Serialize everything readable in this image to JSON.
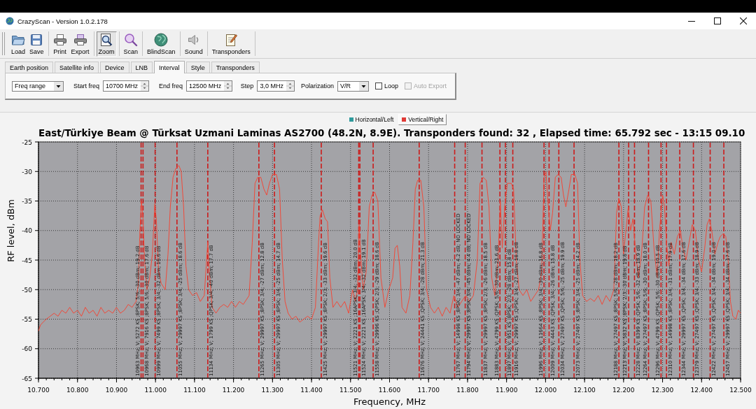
{
  "window": {
    "title": "CrazyScan - Version 1.0.2.178"
  },
  "toolbar": [
    {
      "buttons": [
        {
          "label": "Load",
          "pressed": false
        },
        {
          "label": "Save",
          "pressed": false
        }
      ]
    },
    {
      "buttons": [
        {
          "label": "Print",
          "pressed": false
        },
        {
          "label": "Export",
          "pressed": false
        }
      ]
    },
    {
      "buttons": [
        {
          "label": "Zoom",
          "pressed": true
        }
      ]
    },
    {
      "buttons": [
        {
          "label": "Scan",
          "pressed": false
        }
      ]
    },
    {
      "buttons": [
        {
          "label": "BlindScan",
          "pressed": false
        }
      ]
    },
    {
      "buttons": [
        {
          "label": "Sound",
          "pressed": false
        }
      ]
    },
    {
      "buttons": [
        {
          "label": "Transponders",
          "pressed": false
        }
      ]
    }
  ],
  "tabs": [
    {
      "label": "Earth position",
      "selected": false
    },
    {
      "label": "Satellite info",
      "selected": false
    },
    {
      "label": "Device",
      "selected": false
    },
    {
      "label": "LNB",
      "selected": false
    },
    {
      "label": "Interval",
      "selected": true
    },
    {
      "label": "Style",
      "selected": false
    },
    {
      "label": "Transponders",
      "selected": false
    }
  ],
  "interval_panel": {
    "range_controls": [
      {
        "kind": "dropdown",
        "value": "Freq range"
      },
      {
        "kind": "spinbox",
        "label": "Start freq",
        "value": "10700 MHz"
      },
      {
        "kind": "spinbox",
        "label": "End freq",
        "value": "12500 MHz"
      }
    ],
    "scan_controls": [
      {
        "kind": "spinbox",
        "label": "Step",
        "value": "3,0 MHz"
      },
      {
        "kind": "dropdown",
        "label": "Polarization",
        "value": "V/R"
      },
      {
        "kind": "checkbox",
        "label": "Loop",
        "checked": false,
        "disabled": false
      },
      {
        "kind": "checkbox",
        "label": "Auto Export",
        "checked": false,
        "disabled": true
      }
    ]
  },
  "chart": {
    "legend": [
      {
        "label": "Horizontal/Left",
        "color": "#2f9a9c",
        "selected": false
      },
      {
        "label": "Vertical/Right",
        "color": "#e03a36",
        "selected": true
      }
    ],
    "chart_data": {
      "type": "line",
      "title": "East/Türkiye Beam @ Türksat Uzmani Laminas AS2700 (48.2N, 8.9E). Transponders found: 32 , Elapsed time: 65.792 sec - 13:15 09.10",
      "xlabel": "Frequency, MHz",
      "ylabel": "RF level, dBm",
      "grid": true,
      "xlim": [
        10.7,
        12.5
      ],
      "ylim": [
        -65,
        -25
      ],
      "xticks": [
        {
          "value": 10.7,
          "label": "10.700"
        },
        {
          "value": 10.8,
          "label": "10.800"
        },
        {
          "value": 10.9,
          "label": "10.900"
        },
        {
          "value": 11.0,
          "label": "11.000"
        },
        {
          "value": 11.1,
          "label": "11.100"
        },
        {
          "value": 11.2,
          "label": "11.200"
        },
        {
          "value": 11.3,
          "label": "11.300"
        },
        {
          "value": 11.4,
          "label": "11.400"
        },
        {
          "value": 11.5,
          "label": "11.500"
        },
        {
          "value": 11.6,
          "label": "11.600"
        },
        {
          "value": 11.7,
          "label": "11.700"
        },
        {
          "value": 11.8,
          "label": "11.800"
        },
        {
          "value": 11.9,
          "label": "11.900"
        },
        {
          "value": 12.0,
          "label": "12.000"
        },
        {
          "value": 12.1,
          "label": "12.100"
        },
        {
          "value": 12.2,
          "label": "12.200"
        },
        {
          "value": 12.3,
          "label": "12.300"
        },
        {
          "value": 12.4,
          "label": "12.400"
        },
        {
          "value": 12.5,
          "label": "12.500"
        }
      ],
      "yticks": [
        -25,
        -30,
        -35,
        -40,
        -45,
        -50,
        -55,
        -60,
        -65
      ],
      "x": [
        10.7,
        10.705,
        10.712,
        10.72,
        10.73,
        10.74,
        10.75,
        10.76,
        10.77,
        10.78,
        10.79,
        10.8,
        10.81,
        10.82,
        10.83,
        10.84,
        10.85,
        10.86,
        10.87,
        10.88,
        10.89,
        10.9,
        10.91,
        10.92,
        10.93,
        10.94,
        10.95,
        10.956,
        10.96,
        10.964,
        10.968,
        10.972,
        10.978,
        10.985,
        10.992,
        10.998,
        11.002,
        11.008,
        11.015,
        11.025,
        11.032,
        11.038,
        11.045,
        11.052,
        11.06,
        11.066,
        11.072,
        11.078,
        11.085,
        11.095,
        11.105,
        11.115,
        11.125,
        11.13,
        11.134,
        11.138,
        11.145,
        11.155,
        11.165,
        11.175,
        11.185,
        11.195,
        11.205,
        11.215,
        11.225,
        11.24,
        11.248,
        11.255,
        11.262,
        11.27,
        11.278,
        11.285,
        11.292,
        11.3,
        11.31,
        11.318,
        11.325,
        11.332,
        11.34,
        11.35,
        11.36,
        11.37,
        11.38,
        11.39,
        11.4,
        11.41,
        11.418,
        11.422,
        11.428,
        11.435,
        11.441,
        11.447,
        11.455,
        11.465,
        11.475,
        11.485,
        11.495,
        11.505,
        11.512,
        11.518,
        11.522,
        11.526,
        11.532,
        11.54,
        11.548,
        11.555,
        11.562,
        11.57,
        11.578,
        11.588,
        11.598,
        11.608,
        11.614,
        11.62,
        11.626,
        11.632,
        11.642,
        11.652,
        11.66,
        11.666,
        11.672,
        11.68,
        11.688,
        11.695,
        11.705,
        11.715,
        11.725,
        11.735,
        11.745,
        11.755,
        11.765,
        11.775,
        11.785,
        11.795,
        11.805,
        11.815,
        11.825,
        11.832,
        11.84,
        11.848,
        11.855,
        11.862,
        11.87,
        11.878,
        11.884,
        11.889,
        11.895,
        11.902,
        11.912,
        11.918,
        11.925,
        11.932,
        11.942,
        11.952,
        11.962,
        11.972,
        11.982,
        11.99,
        11.996,
        12.001,
        12.006,
        12.012,
        12.018,
        12.025,
        12.032,
        12.04,
        12.046,
        12.052,
        12.06,
        12.066,
        12.075,
        12.082,
        12.088,
        12.095,
        12.105,
        12.115,
        12.125,
        12.135,
        12.145,
        12.155,
        12.165,
        12.175,
        12.182,
        12.188,
        12.194,
        12.2,
        12.206,
        12.212,
        12.218,
        12.224,
        12.23,
        12.238,
        12.246,
        12.254,
        12.262,
        12.27,
        12.278,
        12.286,
        12.292,
        12.3,
        12.305,
        12.31,
        12.316,
        12.322,
        12.33,
        12.338,
        12.346,
        12.352,
        12.36,
        12.368,
        12.376,
        12.384,
        12.392,
        12.4,
        12.408,
        12.414,
        12.42,
        12.426,
        12.434,
        12.442,
        12.448,
        12.456,
        12.462,
        12.468,
        12.474,
        12.48,
        12.488,
        12.494,
        12.5
      ],
      "values": [
        -57,
        -56,
        -55.5,
        -55,
        -54.5,
        -54,
        -54.5,
        -53.5,
        -54,
        -53,
        -54,
        -53.5,
        -54.5,
        -53,
        -54,
        -53.5,
        -54.5,
        -53,
        -54,
        -53.5,
        -54,
        -53,
        -54,
        -53.5,
        -52.5,
        -53,
        -52,
        -49,
        -40,
        -35,
        -38,
        -45,
        -50,
        -48,
        -44,
        -35.5,
        -38,
        -47,
        -49,
        -50,
        -44,
        -36,
        -31,
        -29.5,
        -29,
        -30,
        -36,
        -46,
        -50,
        -51,
        -50.5,
        -52,
        -51,
        -46,
        -42,
        -47,
        -53,
        -54,
        -53,
        -52.5,
        -53,
        -52,
        -53,
        -52,
        -52.5,
        -51,
        -42,
        -32,
        -31,
        -31,
        -33,
        -34,
        -32,
        -30.5,
        -30.5,
        -33,
        -45,
        -52,
        -54,
        -55,
        -54.5,
        -55.5,
        -55,
        -54.5,
        -55,
        -53,
        -42,
        -37.5,
        -36.5,
        -38,
        -38.5,
        -48,
        -53,
        -52,
        -53,
        -52,
        -54,
        -50,
        -52,
        -50,
        -39,
        -44,
        -50,
        -47,
        -36,
        -34,
        -33.5,
        -35,
        -48,
        -53,
        -50,
        -48,
        -43,
        -42.5,
        -46,
        -53,
        -54,
        -51,
        -42,
        -33,
        -31.5,
        -31.5,
        -36,
        -50,
        -53,
        -54,
        -53,
        -54.5,
        -53,
        -54,
        -51,
        -53,
        -52,
        -51,
        -52,
        -51,
        -45,
        -32,
        -31,
        -31.5,
        -36,
        -48,
        -51,
        -45,
        -35,
        -43,
        -36,
        -32,
        -32,
        -33,
        -45,
        -50,
        -51,
        -50,
        -52,
        -51,
        -50,
        -47,
        -31,
        -30,
        -35,
        -40,
        -37,
        -31,
        -30.5,
        -31,
        -34,
        -36,
        -33,
        -30.5,
        -30.5,
        -32,
        -45,
        -51,
        -52,
        -51.5,
        -52,
        -51,
        -52.5,
        -51,
        -52,
        -50,
        -37,
        -34.5,
        -36,
        -44,
        -40,
        -36,
        -40,
        -38,
        -43,
        -48,
        -44,
        -36,
        -34,
        -35,
        -43,
        -48,
        -40,
        -34,
        -36,
        -42,
        -46,
        -42,
        -44,
        -41,
        -40,
        -43,
        -45,
        -42,
        -39,
        -40,
        -45,
        -47,
        -43,
        -39,
        -38,
        -40,
        -44,
        -42,
        -41,
        -40.5,
        -41,
        -45,
        -52,
        -54.5,
        -55,
        -53.5,
        -54
      ],
      "ref_lines": [
        {
          "axis": "x",
          "value": 10.963,
          "label": "10963 MHz; V; 5272 KS ;8PSK; 5/6; -30 dBm; 19.2 dB"
        },
        {
          "axis": "x",
          "value": 10.968,
          "label": "10968 MHz; V; 7916 KS ;8PSK; 5/6; -30 dBm; 17.6 dB"
        },
        {
          "axis": "x",
          "value": 10.999,
          "label": "10999 MHz; V; 7499 KS ;8PSK; 3/4; -32 dBm; 16.6 dB"
        },
        {
          "axis": "x",
          "value": 11.055,
          "label": "11055 MHz; V; 29997 KS ;8PSK; 3/4; -25 dBm; 18.6 dB"
        },
        {
          "axis": "x",
          "value": 11.134,
          "label": "11134 MHz; V; 1799 KS ;QPSK; 3/4; -40 dBm; 17.7 dB"
        },
        {
          "axis": "x",
          "value": 11.265,
          "label": "11265 MHz; V; 29997 KS ;8PSK; 3/4; -27 dBm; 12.8 dB"
        },
        {
          "axis": "x",
          "value": 11.305,
          "label": "11305 MHz; V; 29997 KS ;8PSK; 3/4; -25 dBm; 14.7 dB"
        },
        {
          "axis": "x",
          "value": 11.425,
          "label": "11425 MHz; V; 29997 KS ;8PSK; 2/3; -33 dBm; 19.6 dB"
        },
        {
          "axis": "x",
          "value": 11.521,
          "label": "11521 MHz; V; 2221 KS ;16APSK; 3/4; -32 dBm; 20.0 dB"
        },
        {
          "axis": "x",
          "value": 11.524,
          "label": "11524 MHz; V; 2221 KS ;16APSK; 3/4; -32 dBm; 19.1 dB"
        },
        {
          "axis": "x",
          "value": 11.558,
          "label": "11558 MHz; V; 29996 KS ;QPSK; 2/3; -29 dBm; 18.6 dB"
        },
        {
          "axis": "x",
          "value": 11.676,
          "label": "11676 MHz; V; 24441 KS ;QPSK; 3/4; -28 dBm; 21.3 dB"
        },
        {
          "axis": "x",
          "value": 11.767,
          "label": "11767 MHz; V; 14998 KS ;8PSK; 3/4; -47 dBm; 4.2 dB; NO LOCKED"
        },
        {
          "axis": "x",
          "value": 11.794,
          "label": "11794 MHz; V; 29997 KS ;8PSK; 3/4; -45 dBm; 4.4 dB; NO LOCKED"
        },
        {
          "axis": "x",
          "value": 11.837,
          "label": "11837 MHz; V; 29997 KS ;8PSK; 2/3; -26 dBm; 18.5 dB"
        },
        {
          "axis": "x",
          "value": 11.883,
          "label": "11883 MHz; V; 4799 KS ;QPSK; 5/6; -30 dBm; 21.6 dB"
        },
        {
          "axis": "x",
          "value": 11.897,
          "label": "11897 MHz; V; 951 KS ;8PSK; 2/3; -28 dBm; 15.8 dB"
        },
        {
          "axis": "x",
          "value": 11.916,
          "label": "11916 MHz; V; 29997 KS ;QPSK; 3/4; -27 dBm; 18.8 dB"
        },
        {
          "axis": "x",
          "value": 11.996,
          "label": "11996 MHz; V; 11664 KS ;8PSK; 3/4; -30 dBm; 16.8 dB"
        },
        {
          "axis": "x",
          "value": 12.009,
          "label": "12009 MHz; V; 4443 KS ;QPSK; 3/4; -26 dBm; 15.8 dB"
        },
        {
          "axis": "x",
          "value": 12.034,
          "label": "12034 MHz; V; 27497 KS ;QPSK; 5/6; -25 dBm; 19.9 dB"
        },
        {
          "axis": "x",
          "value": 12.073,
          "label": "12073 MHz; V; 27497 KS ;8PSK; 3/4; -25 dBm; 14.2 dB"
        },
        {
          "axis": "x",
          "value": 12.188,
          "label": "12188 MHz; V; 27497 KS ;8PSK; 5/6; -28 dBm; 18.2 dB"
        },
        {
          "axis": "x",
          "value": 12.213,
          "label": "12213 MHz; V; 5832 KS ;8PSK; 2/3; -30 dBm; 19.8 dB"
        },
        {
          "axis": "x",
          "value": 12.228,
          "label": "12228 MHz; V; 8399 KS ;QPSK; 5/6; -32 dBm; 18.9 dB"
        },
        {
          "axis": "x",
          "value": 12.264,
          "label": "12264 MHz; V; 27497 KS ;8PSK; 5/6; -30 dBm; 18.0 dB"
        },
        {
          "axis": "x",
          "value": 12.296,
          "label": "12296 MHz; V; 4799 KS ;QPSK; 5/6; -30 dBm; 10.5 dB"
        },
        {
          "axis": "x",
          "value": 12.31,
          "label": "12310 MHz; V; 14998 KS ;8PSK; 3/4; -31 dBm; 17.9 dB"
        },
        {
          "axis": "x",
          "value": 12.344,
          "label": "12344 MHz; V; 29997 KS ;QPSK; 3/4; -34 dBm; 17.6 dB"
        },
        {
          "axis": "x",
          "value": 12.379,
          "label": "12379 MHz; V; 27497 KS ;QPSK; 3/4; -33 dBm; 18.9 dB"
        },
        {
          "axis": "x",
          "value": 12.422,
          "label": "12422 MHz; V; 27497 KS ;QPSK; 3/4; -34 dBm; 19.0 dB"
        },
        {
          "axis": "x",
          "value": 12.457,
          "label": "12457 MHz; V; 29997 KS ;QPSK; 3/4; -34 dBm; 17.6 dB"
        }
      ]
    }
  }
}
